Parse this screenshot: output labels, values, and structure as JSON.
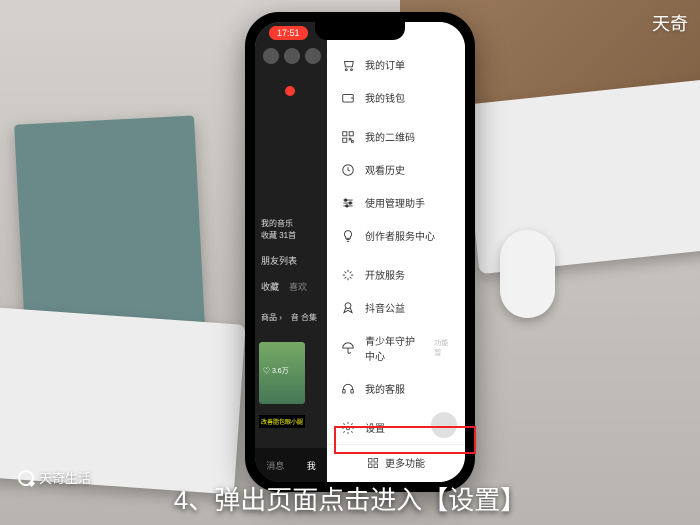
{
  "statusbar": {
    "time": "17:51"
  },
  "leftPane": {
    "music_label": "我的音乐",
    "music_sub": "收藏 31首",
    "friends_label": "朋友列表",
    "tabs": {
      "coll": "收藏",
      "fav": "喜欢"
    },
    "row": {
      "goods": "商品 ›",
      "sound": "音  合集"
    },
    "thumb_caption": "改善脂包眼小腿",
    "likes": "♡ 3.6万",
    "bottom": {
      "msg": "消息",
      "me": "我"
    }
  },
  "menu": {
    "items": [
      {
        "label": "我的订单"
      },
      {
        "label": "我的钱包"
      },
      {
        "label": "我的二维码"
      },
      {
        "label": "观看历史"
      },
      {
        "label": "使用管理助手"
      },
      {
        "label": "创作者服务中心"
      },
      {
        "label": "开放服务"
      },
      {
        "label": "抖音公益"
      },
      {
        "label": "青少年守护中心",
        "sublabel": "功能暂"
      },
      {
        "label": "我的客服"
      },
      {
        "label": "设置"
      }
    ],
    "more": "更多功能"
  },
  "overlay": {
    "brand_corner": "天奇",
    "watermark": "天奇生活",
    "caption": "4、弹出页面点击进入【设置】"
  }
}
